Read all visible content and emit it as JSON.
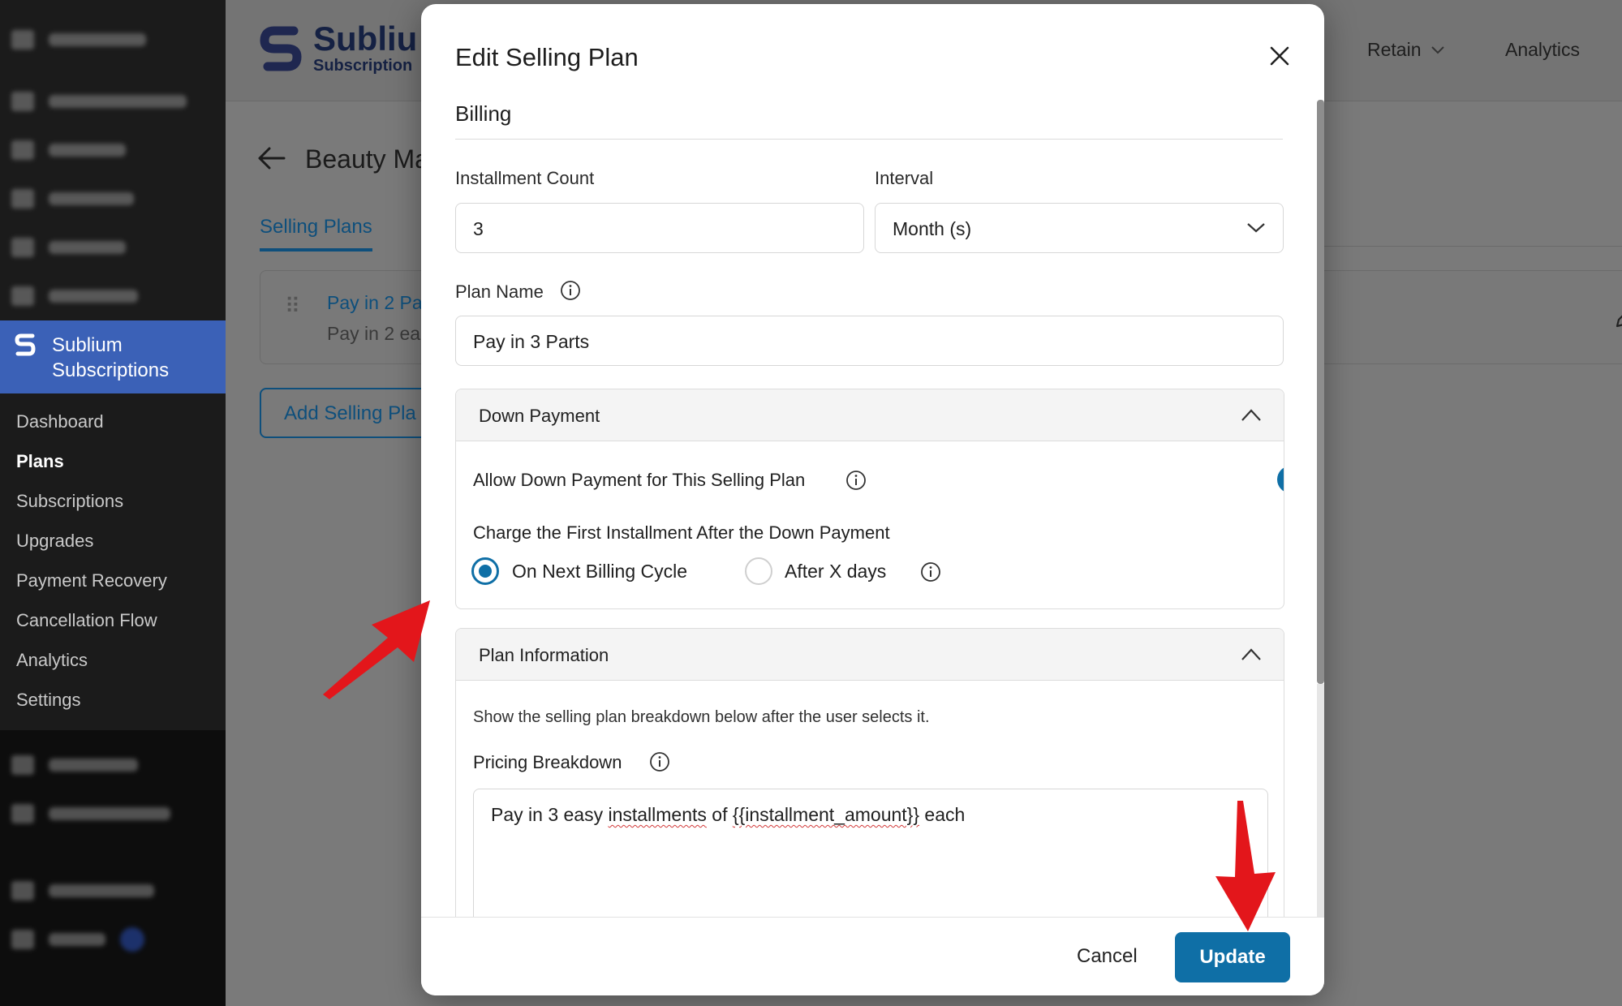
{
  "sidebar": {
    "plugin_name": "Sublium Subscriptions",
    "items": [
      {
        "label": "Dashboard"
      },
      {
        "label": "Plans"
      },
      {
        "label": "Subscriptions"
      },
      {
        "label": "Upgrades"
      },
      {
        "label": "Payment Recovery"
      },
      {
        "label": "Cancellation Flow"
      },
      {
        "label": "Analytics"
      },
      {
        "label": "Settings"
      }
    ]
  },
  "header": {
    "brand_name": "Subliu",
    "brand_sub": "Subscription",
    "nav": [
      {
        "label": "Retain"
      },
      {
        "label": "Analytics"
      }
    ]
  },
  "page": {
    "title": "Beauty Ma",
    "tab_active": "Selling Plans",
    "plan_card": {
      "title": "Pay in 2 Pa",
      "subtitle": "Pay in 2 ea"
    },
    "add_button": "Add Selling Pla"
  },
  "modal": {
    "title": "Edit Selling Plan",
    "billing_heading": "Billing",
    "installment_count_label": "Installment Count",
    "installment_count_value": "3",
    "interval_label": "Interval",
    "interval_value": "Month (s)",
    "plan_name_label": "Plan Name",
    "plan_name_value": "Pay in 3 Parts",
    "down_payment": {
      "title": "Down Payment",
      "allow_label": "Allow Down Payment for This Selling Plan",
      "allow_enabled": true,
      "charge_label": "Charge the First Installment After the Down Payment",
      "options": [
        {
          "label": "On Next Billing Cycle",
          "selected": true
        },
        {
          "label": "After X days",
          "selected": false
        }
      ]
    },
    "plan_information": {
      "title": "Plan Information",
      "description": "Show the selling plan breakdown below after the user selects it.",
      "pricing_label": "Pricing Breakdown",
      "pricing_text_before": "Pay in 3 easy ",
      "pricing_text_flagged_1": "installments",
      "pricing_text_mid": " of ",
      "pricing_text_flagged_2": "{{installment_amount}}",
      "pricing_text_after": " each"
    },
    "cancel_label": "Cancel",
    "update_label": "Update"
  },
  "colors": {
    "accent": "#0f6fa6",
    "sidebar_active": "#3b61b7",
    "annotation_arrow": "#e3161b"
  }
}
